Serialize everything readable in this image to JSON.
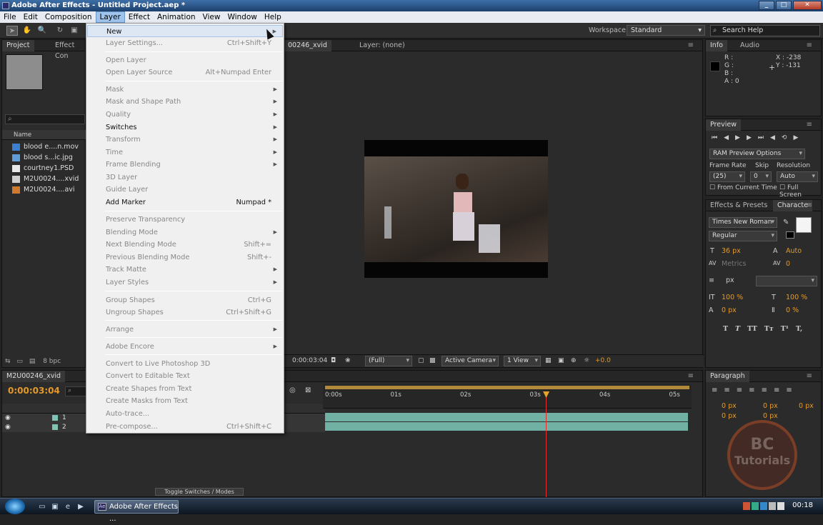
{
  "window": {
    "title": "Adobe After Effects - Untitled Project.aep *"
  },
  "menubar": [
    "File",
    "Edit",
    "Composition",
    "Layer",
    "Effect",
    "Animation",
    "View",
    "Window",
    "Help"
  ],
  "toolbar": {
    "workspace_label": "Workspace:",
    "workspace_value": "Standard",
    "search_placeholder": "Search Help"
  },
  "layer_menu": [
    {
      "label": "New",
      "shortcut": "",
      "submenu": true,
      "enabled": true,
      "highlight": true
    },
    {
      "label": "Layer Settings...",
      "shortcut": "Ctrl+Shift+Y",
      "submenu": false,
      "enabled": false
    },
    {
      "sep": true
    },
    {
      "label": "Open Layer",
      "shortcut": "",
      "submenu": false,
      "enabled": false
    },
    {
      "label": "Open Layer Source",
      "shortcut": "Alt+Numpad Enter",
      "submenu": false,
      "enabled": false
    },
    {
      "sep": true
    },
    {
      "label": "Mask",
      "shortcut": "",
      "submenu": true,
      "enabled": false
    },
    {
      "label": "Mask and Shape Path",
      "shortcut": "",
      "submenu": true,
      "enabled": false
    },
    {
      "label": "Quality",
      "shortcut": "",
      "submenu": true,
      "enabled": false
    },
    {
      "label": "Switches",
      "shortcut": "",
      "submenu": true,
      "enabled": true
    },
    {
      "label": "Transform",
      "shortcut": "",
      "submenu": true,
      "enabled": false
    },
    {
      "label": "Time",
      "shortcut": "",
      "submenu": true,
      "enabled": false
    },
    {
      "label": "Frame Blending",
      "shortcut": "",
      "submenu": true,
      "enabled": false
    },
    {
      "label": "3D Layer",
      "shortcut": "",
      "submenu": false,
      "enabled": false
    },
    {
      "label": "Guide Layer",
      "shortcut": "",
      "submenu": false,
      "enabled": false
    },
    {
      "label": "Add Marker",
      "shortcut": "Numpad *",
      "submenu": false,
      "enabled": true
    },
    {
      "sep": true
    },
    {
      "label": "Preserve Transparency",
      "shortcut": "",
      "submenu": false,
      "enabled": false
    },
    {
      "label": "Blending Mode",
      "shortcut": "",
      "submenu": true,
      "enabled": false
    },
    {
      "label": "Next Blending Mode",
      "shortcut": "Shift+=",
      "submenu": false,
      "enabled": false
    },
    {
      "label": "Previous Blending Mode",
      "shortcut": "Shift+-",
      "submenu": false,
      "enabled": false
    },
    {
      "label": "Track Matte",
      "shortcut": "",
      "submenu": true,
      "enabled": false
    },
    {
      "label": "Layer Styles",
      "shortcut": "",
      "submenu": true,
      "enabled": false
    },
    {
      "sep": true
    },
    {
      "label": "Group Shapes",
      "shortcut": "Ctrl+G",
      "submenu": false,
      "enabled": false
    },
    {
      "label": "Ungroup Shapes",
      "shortcut": "Ctrl+Shift+G",
      "submenu": false,
      "enabled": false
    },
    {
      "sep": true
    },
    {
      "label": "Arrange",
      "shortcut": "",
      "submenu": true,
      "enabled": false
    },
    {
      "sep": true
    },
    {
      "label": "Adobe Encore",
      "shortcut": "",
      "submenu": true,
      "enabled": false
    },
    {
      "sep": true
    },
    {
      "label": "Convert to Live Photoshop 3D",
      "shortcut": "",
      "submenu": false,
      "enabled": false
    },
    {
      "label": "Convert to Editable Text",
      "shortcut": "",
      "submenu": false,
      "enabled": false
    },
    {
      "label": "Create Shapes from Text",
      "shortcut": "",
      "submenu": false,
      "enabled": false
    },
    {
      "label": "Create Masks from Text",
      "shortcut": "",
      "submenu": false,
      "enabled": false
    },
    {
      "label": "Auto-trace...",
      "shortcut": "",
      "submenu": false,
      "enabled": false
    },
    {
      "label": "Pre-compose...",
      "shortcut": "Ctrl+Shift+C",
      "submenu": false,
      "enabled": false
    }
  ],
  "project_panel": {
    "tabs": [
      "Project",
      "Effect Con"
    ],
    "column_name": "Name",
    "bpc": "8 bpc",
    "files": [
      {
        "name": "blood e....n.mov",
        "icon_color": "#3a7fd0"
      },
      {
        "name": "blood s...ic.jpg",
        "icon_color": "#5f9cd8"
      },
      {
        "name": "courtney1.PSD",
        "icon_color": "#e8e8e8"
      },
      {
        "name": "M2U0024....xvid",
        "icon_color": "#cfcfcf"
      },
      {
        "name": "M2U0024....avi",
        "icon_color": "#d07a30"
      }
    ]
  },
  "comp_panel": {
    "tab": "00246_xvid",
    "layer_tab": "Layer: (none)",
    "timecode": "0:00:03:04",
    "resolution": "(Full)",
    "camera": "Active Camera",
    "view": "1 View",
    "exposure": "+0.0"
  },
  "info_panel": {
    "tabs": [
      "Info",
      "Audio"
    ],
    "r": "R :",
    "g": "G :",
    "b": "B :",
    "a": "A : 0",
    "x": "X : -238",
    "y": "Y : -131"
  },
  "preview_panel": {
    "title": "Preview",
    "ram_options": "RAM Preview Options",
    "frame_rate_label": "Frame Rate",
    "skip_label": "Skip",
    "resolution_label": "Resolution",
    "frame_rate": "(25)",
    "skip": "0",
    "resolution": "Auto",
    "from_current_time": "From Current Time",
    "full_screen": "Full Screen"
  },
  "character_panel": {
    "tabs": [
      "Effects & Presets",
      "Characte"
    ],
    "font": "Times New Roman",
    "style": "Regular",
    "size": "36 px",
    "leading": "Auto",
    "kerning": "Metrics",
    "tracking": "0",
    "stroke_unit": "px",
    "vscale": "100 %",
    "hscale": "100 %",
    "baseline": "0 px",
    "tsume": "0 %",
    "styles": [
      "T",
      "T",
      "TT",
      "Tт",
      "T¹",
      "T,"
    ]
  },
  "timeline": {
    "tab": "M2U00246_xvid",
    "timecode": "0:00:03:04",
    "rows": [
      {
        "num": "1"
      },
      {
        "num": "2"
      }
    ],
    "ruler": [
      "0:00s",
      "01s",
      "02s",
      "03s",
      "04s",
      "05s"
    ],
    "toggle_label": "Toggle Switches / Modes",
    "current_time_sec": 3.17,
    "duration_sec": 5.2
  },
  "paragraph_panel": {
    "title": "Paragraph",
    "indent1": "0 px",
    "indent2": "0 px",
    "indent3": "0 px",
    "space1": "0 px",
    "space2": "0 px"
  },
  "watermark": {
    "line1": "BC",
    "line2": "Tutorials"
  },
  "taskbar": {
    "task": "Adobe After Effects ...",
    "clock": "00:18"
  }
}
